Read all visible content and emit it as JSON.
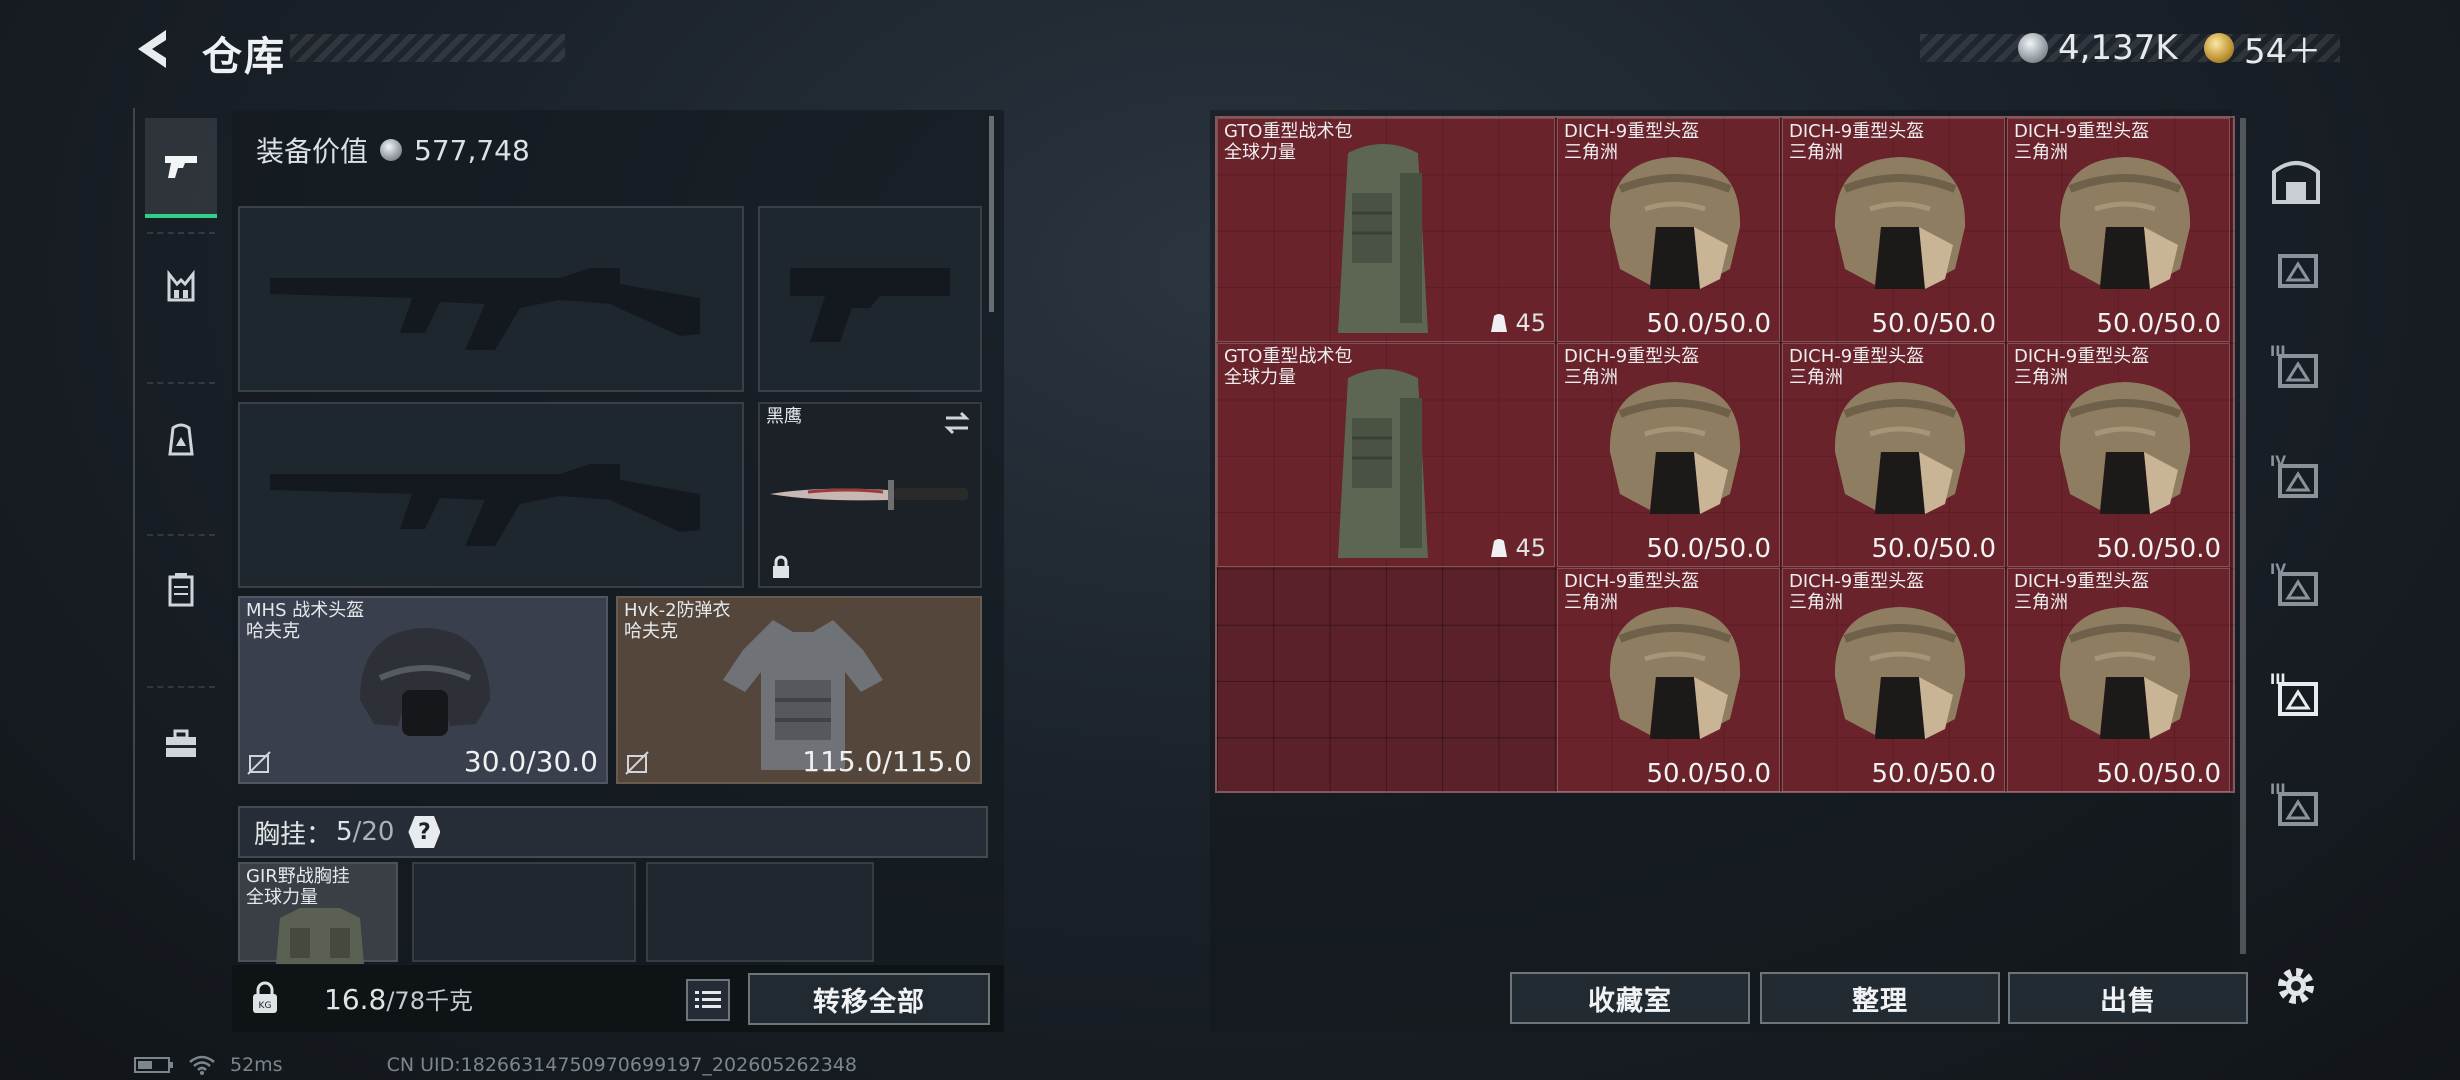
{
  "header": {
    "title": "仓库",
    "currency_silver": "4,137K",
    "currency_gold": "54＋"
  },
  "left_tabs": [
    {
      "name": "pistol-tab-icon"
    },
    {
      "name": "harness-tab-icon"
    },
    {
      "name": "backpack-tab-icon"
    },
    {
      "name": "container-tab-icon"
    },
    {
      "name": "toolbox-tab-icon"
    }
  ],
  "loadout": {
    "equip_value_label": "装备价值",
    "equip_value": "577,748",
    "knife": {
      "name": "黑鹰"
    },
    "helmet": {
      "name": "MHS 战术头盔",
      "maker": "哈夫克",
      "durability": "30.0/30.0"
    },
    "armor": {
      "name": "Hvk-2防弹衣",
      "maker": "哈夫克",
      "durability": "115.0/115.0"
    },
    "chest_label": "胸挂：",
    "chest_used": "5",
    "chest_total": "/20",
    "chest_help": "?",
    "chest_item": {
      "name": "GIR野战胸挂",
      "maker": "全球力量"
    },
    "weight_current": "16.8",
    "weight_max": "/78千克",
    "transfer_all": "转移全部"
  },
  "stash": {
    "backpacks": [
      {
        "name": "GTO重型战术包",
        "maker": "全球力量",
        "capacity": "45"
      },
      {
        "name": "GTO重型战术包",
        "maker": "全球力量",
        "capacity": "45"
      }
    ],
    "helmets": [
      {
        "name": "DICH-9重型头盔",
        "maker": "三角洲",
        "durability": "50.0/50.0"
      },
      {
        "name": "DICH-9重型头盔",
        "maker": "三角洲",
        "durability": "50.0/50.0"
      },
      {
        "name": "DICH-9重型头盔",
        "maker": "三角洲",
        "durability": "50.0/50.0"
      },
      {
        "name": "DICH-9重型头盔",
        "maker": "三角洲",
        "durability": "50.0/50.0"
      },
      {
        "name": "DICH-9重型头盔",
        "maker": "三角洲",
        "durability": "50.0/50.0"
      },
      {
        "name": "DICH-9重型头盔",
        "maker": "三角洲",
        "durability": "50.0/50.0"
      },
      {
        "name": "DICH-9重型头盔",
        "maker": "三角洲",
        "durability": "50.0/50.0"
      },
      {
        "name": "DICH-9重型头盔",
        "maker": "三角洲",
        "durability": "50.0/50.0"
      },
      {
        "name": "DICH-9重型头盔",
        "maker": "三角洲",
        "durability": "50.0/50.0"
      }
    ],
    "buttons": {
      "collection": "收藏室",
      "sort": "整理",
      "sell": "出售"
    }
  },
  "right_tabs": [
    {
      "name": "stash-home-icon",
      "roman": ""
    },
    {
      "name": "stash-tab-2-icon",
      "roman": ""
    },
    {
      "name": "stash-tab-3-icon",
      "roman": "III"
    },
    {
      "name": "stash-tab-4-icon",
      "roman": "IV"
    },
    {
      "name": "stash-tab-5-icon",
      "roman": "IV"
    },
    {
      "name": "stash-tab-6-icon",
      "roman": "III"
    },
    {
      "name": "stash-tab-7-icon",
      "roman": "III"
    }
  ],
  "status": {
    "ping": "52ms",
    "uid": "CN UID:18266314750970699197_202605262348"
  }
}
